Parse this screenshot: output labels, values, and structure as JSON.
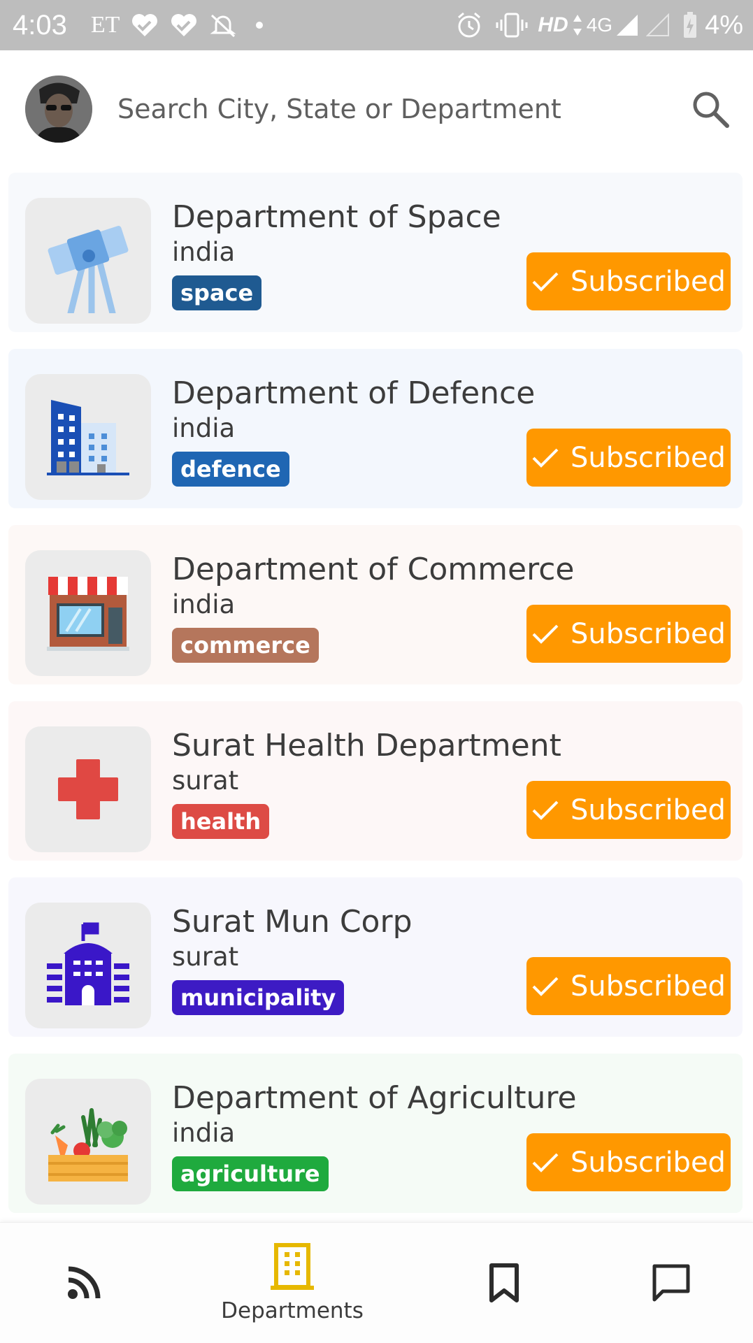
{
  "status_bar": {
    "time": "4:03",
    "carrier": "ET",
    "network": "HD",
    "signal": "4G",
    "battery": "4%"
  },
  "search": {
    "placeholder": "Search City, State or Department"
  },
  "departments": [
    {
      "title": "Department of Space",
      "location": "india",
      "tag": "space",
      "tag_color": "#1f5a91",
      "card_bg": "#f7f9fc",
      "icon": "telescope-icon",
      "button": "Subscribed"
    },
    {
      "title": "Department of Defence",
      "location": "india",
      "tag": "defence",
      "tag_color": "#1f66b3",
      "card_bg": "#f3f7fd",
      "icon": "office-building-icon",
      "button": "Subscribed"
    },
    {
      "title": "Department of Commerce",
      "location": "india",
      "tag": "commerce",
      "tag_color": "#b5765c",
      "card_bg": "#fdf8f6",
      "icon": "shop-icon",
      "button": "Subscribed"
    },
    {
      "title": "Surat Health Department",
      "location": "surat",
      "tag": "health",
      "tag_color": "#dd4b45",
      "card_bg": "#fdf7f7",
      "icon": "medical-cross-icon",
      "button": "Subscribed"
    },
    {
      "title": "Surat Mun Corp",
      "location": "surat",
      "tag": "municipality",
      "tag_color": "#3d1bc4",
      "card_bg": "#f7f7fd",
      "icon": "municipal-building-icon",
      "button": "Subscribed"
    },
    {
      "title": "Department of Agriculture",
      "location": "india",
      "tag": "agriculture",
      "tag_color": "#1faa3e",
      "card_bg": "#f5fbf6",
      "icon": "vegetables-crate-icon",
      "button": "Subscribed"
    }
  ],
  "nav": {
    "departments_label": "Departments",
    "active_color": "#e6b800"
  }
}
